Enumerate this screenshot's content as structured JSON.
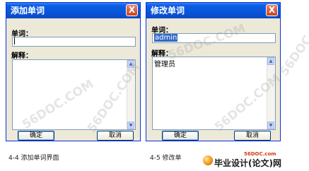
{
  "add_dialog": {
    "title": "添加单词",
    "close_label": "X",
    "word_label": "单词：",
    "word_value": "",
    "meaning_label": "解释：",
    "meaning_value": "",
    "ok_label": "确定",
    "cancel_label": "取消"
  },
  "edit_dialog": {
    "title": "修改单词",
    "close_label": "X",
    "word_label": "单词：",
    "word_value": "admin",
    "meaning_label": "解释：",
    "meaning_value": "管理员",
    "ok_label": "确定",
    "cancel_label": "取消"
  },
  "captions": {
    "left": "4-4    添加单词界面",
    "right": "4-5    修改单"
  },
  "logo": {
    "site": "56DOC.com",
    "text": "毕业设计(论文)网"
  },
  "watermarks": [
    "56DOC.COM",
    "56DOC.COM",
    "56DOC.COM",
    "56DOC.COM",
    "56DOC.COM"
  ],
  "colors": {
    "titlebar": "#0a55d8",
    "dialog_bg": "#ece9d8",
    "close_button": "#c84225",
    "selection": "#316ac5"
  },
  "icons": {
    "close": "close-icon",
    "scroll_up": "scroll-up-arrow-icon",
    "scroll_down": "scroll-down-arrow-icon",
    "logo_ball": "logo-ball-icon"
  }
}
